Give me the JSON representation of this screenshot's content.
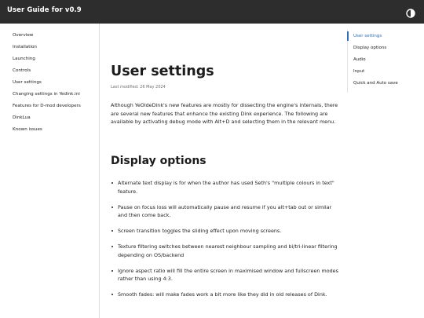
{
  "header": {
    "title": "User Guide for v0.9",
    "theme_toggle_icon": "half-moon-icon"
  },
  "sidebar": {
    "items": [
      {
        "label": "Overview"
      },
      {
        "label": "Installation"
      },
      {
        "label": "Launching"
      },
      {
        "label": "Controls"
      },
      {
        "label": "User settings"
      },
      {
        "label": "Changing settings in Yedink.ini"
      },
      {
        "label": "Features for D-mod developers"
      },
      {
        "label": "DinkLua"
      },
      {
        "label": "Known issues"
      }
    ]
  },
  "main": {
    "title": "User settings",
    "last_modified": "Last modified: 26 May 2024",
    "intro": "Although YeOldeDink's new features are mostly for dissecting the engine's internals, there are several new features that enhance the existing Dink experience. The following are available by activating debug mode with Alt+D and selecting them in the relevant menu.",
    "section_title": "Display options",
    "bullets": [
      "Alternate text display is for when the author has used Seth's \"multiple colours in text\" feature.",
      "Pause on focus loss will automatically pause and resume if you alt+tab out or similar and then come back.",
      "Screen transition toggles the sliding effect upon moving screens.",
      "Texture filtering switches between nearest neighbour sampling and bi/tri-linear filtering depending on OS/backend",
      "Ignore aspect ratio will fill the entire screen in maximised window and fullscreen modes rather than using 4:3.",
      "Smooth fades: will make fades work a bit more like they did in old releases of Dink."
    ]
  },
  "toc": {
    "items": [
      {
        "label": "User settings",
        "active": true
      },
      {
        "label": "Display options",
        "active": false
      },
      {
        "label": "Audio",
        "active": false
      },
      {
        "label": "Input",
        "active": false
      },
      {
        "label": "Quick and Auto save",
        "active": false
      }
    ]
  },
  "colors": {
    "header_bg": "#2d2d2d",
    "accent": "#2f6fb3"
  }
}
